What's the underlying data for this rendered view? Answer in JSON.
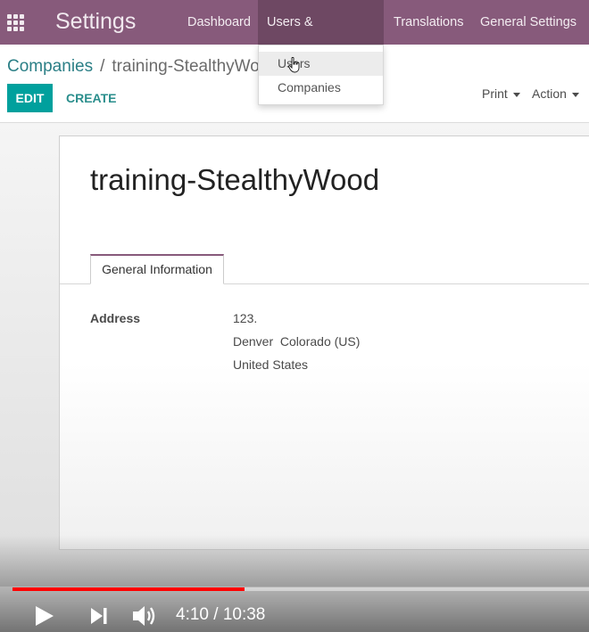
{
  "navbar": {
    "brand": "Settings",
    "menu": [
      {
        "label": "Dashboard"
      },
      {
        "label": "Users & Companies"
      },
      {
        "label": "Translations"
      },
      {
        "label": "General Settings"
      }
    ],
    "color": "#875a7b"
  },
  "dropdown": {
    "items": [
      {
        "label": "Users"
      },
      {
        "label": "Companies"
      }
    ]
  },
  "breadcrumb": {
    "parent": "Companies",
    "separator": "/",
    "current": "training-StealthyWo"
  },
  "control_panel": {
    "edit_label": "EDIT",
    "create_label": "CREATE",
    "print_label": "Print",
    "action_label": "Action"
  },
  "form": {
    "title": "training-StealthyWood",
    "tab_label": "General Information",
    "address_label": "Address",
    "address_lines": [
      "123.",
      "Denver  Colorado (US)",
      "United States"
    ]
  },
  "player": {
    "time": "4:10 / 10:38",
    "progress": 0.402,
    "icons": [
      "play-icon",
      "next-icon",
      "volume-icon"
    ]
  },
  "colors": {
    "accent": "#00a09d",
    "link": "#2b7f86",
    "progress": "#ff0000"
  }
}
